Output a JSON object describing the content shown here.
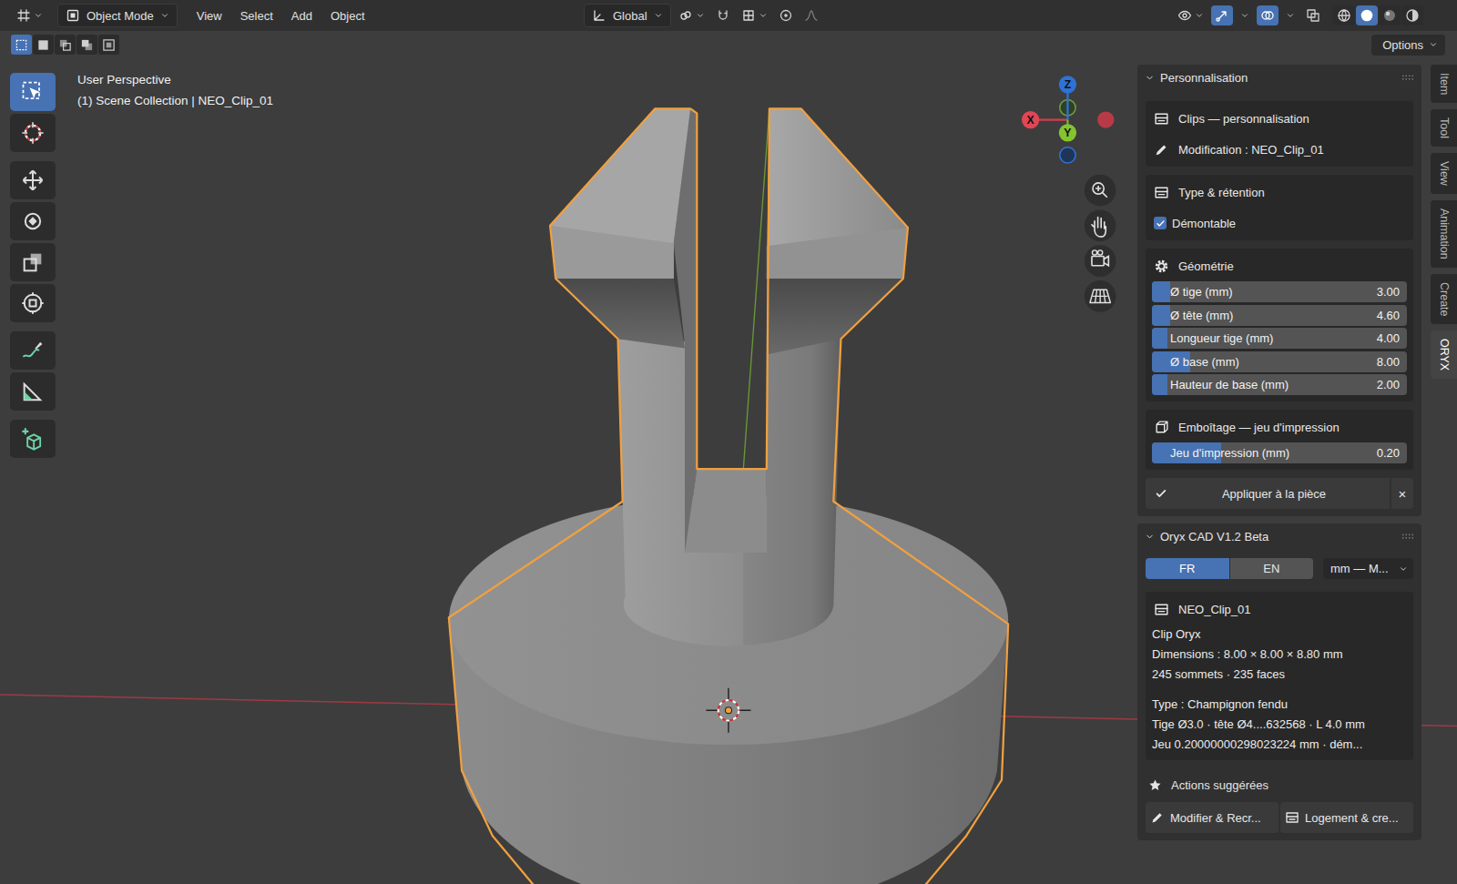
{
  "header": {
    "mode": "Object Mode",
    "menus": [
      "View",
      "Select",
      "Add",
      "Object"
    ],
    "orientation": "Global",
    "snap_on": false,
    "proportional_on": false,
    "gizmos_on": true,
    "overlays_on": true,
    "xray_on": false,
    "shading": [
      {
        "selected": false
      },
      {
        "selected": true
      },
      {
        "selected": false
      },
      {
        "selected": false
      }
    ]
  },
  "tool_header": {
    "select_modes": [
      {
        "selected": true
      },
      {
        "selected": false
      },
      {
        "selected": false
      },
      {
        "selected": false
      },
      {
        "selected": false
      }
    ],
    "options": "Options"
  },
  "tools": [
    {
      "selected": true
    },
    {
      "selected": false
    },
    {
      "selected": false
    },
    {
      "selected": false
    },
    {
      "selected": false
    },
    {
      "selected": false
    },
    {
      "selected": false
    },
    {
      "selected": false
    },
    {
      "selected": false
    }
  ],
  "viewport": {
    "view": "User Perspective",
    "collection": "(1) Scene Collection | NEO_Clip_01",
    "axes": {
      "x": "X",
      "y": "Y",
      "z": "Z"
    }
  },
  "sidebar": {
    "tabs": [
      {
        "label": "Item",
        "selected": false
      },
      {
        "label": "Tool",
        "selected": false
      },
      {
        "label": "View",
        "selected": false
      },
      {
        "label": "Animation",
        "selected": false
      },
      {
        "label": "Create",
        "selected": false
      },
      {
        "label": "ORYX",
        "selected": true
      }
    ],
    "personalisation": {
      "title": "Personnalisation",
      "intro": {
        "title": "Clips — personnalisation",
        "subtitle": "Modification : NEO_Clip_01"
      },
      "retention": {
        "title": "Type & rétention",
        "checkbox": {
          "label": "Démontable",
          "checked": true
        }
      },
      "geometry": {
        "title": "Géométrie",
        "sliders": [
          {
            "label": "Ø tige (mm)",
            "value": "3.00",
            "level": 0.07
          },
          {
            "label": "Ø tête (mm)",
            "value": "4.60",
            "level": 0.07
          },
          {
            "label": "Longueur tige (mm)",
            "value": "4.00",
            "level": 0.06
          },
          {
            "label": "Ø base (mm)",
            "value": "8.00",
            "level": 0.15
          },
          {
            "label": "Hauteur de base (mm)",
            "value": "2.00",
            "level": 0.06
          }
        ]
      },
      "fit": {
        "title": "Emboîtage — jeu d'impression",
        "slider": {
          "label": "Jeu d'impression (mm)",
          "value": "0.20",
          "level": 0.27
        }
      },
      "apply": {
        "label": "Appliquer à la pièce",
        "close": "×"
      }
    },
    "oryx": {
      "title": "Oryx CAD V1.2 Beta",
      "languages": [
        {
          "label": "FR",
          "selected": true
        },
        {
          "label": "EN",
          "selected": false
        }
      ],
      "units": "mm — M...",
      "info": {
        "name": "NEO_Clip_01",
        "groups": [
          [
            "Clip Oryx",
            "Dimensions : 8.00 × 8.00 × 8.80 mm",
            "245 sommets · 235 faces"
          ],
          [
            "Type : Champignon fendu",
            "Tige Ø3.0 · tête Ø4....632568 · L 4.0 mm",
            "Jeu 0.20000000298023224 mm · dém..."
          ]
        ]
      },
      "actions_title": "Actions suggérées",
      "actions": [
        "Modifier & Recr...",
        "Logement & cre..."
      ]
    }
  }
}
